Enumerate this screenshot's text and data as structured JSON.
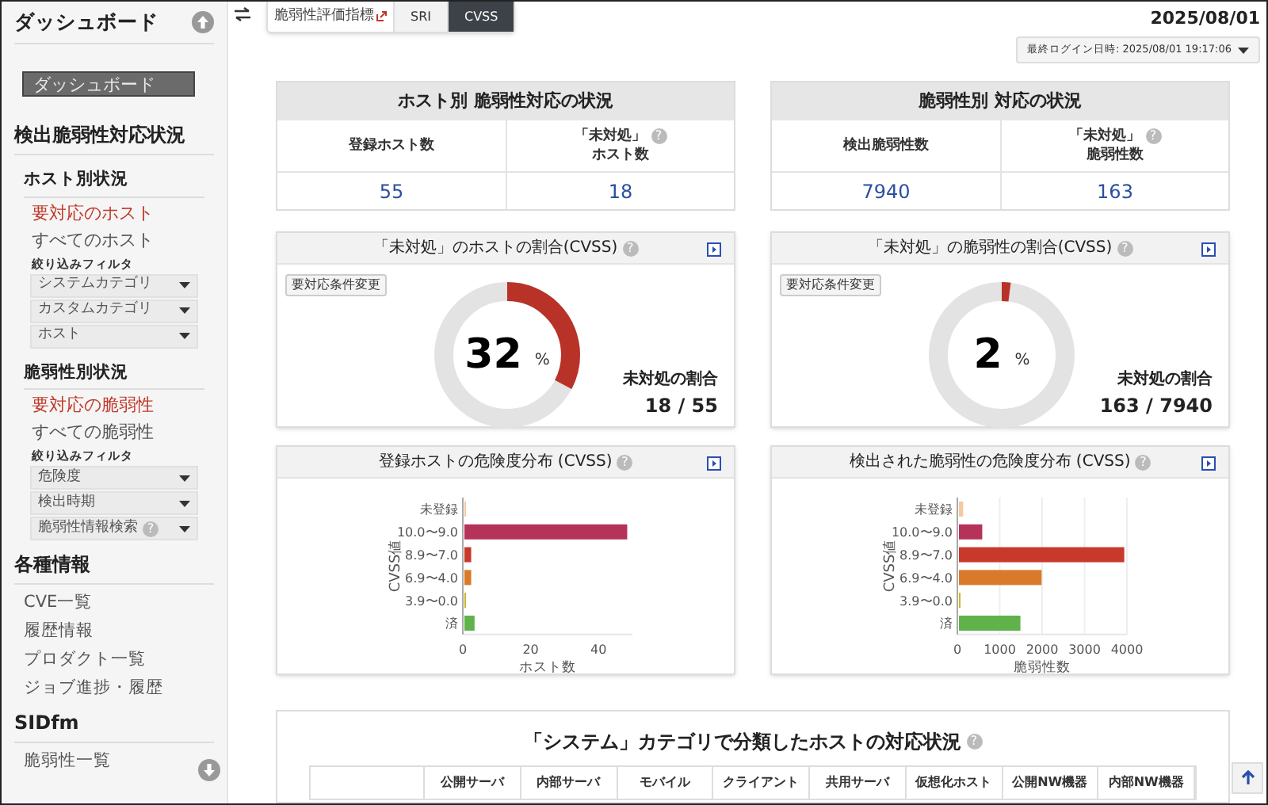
{
  "sidebar": {
    "title": "ダッシュボード",
    "items": [
      {
        "kind": "button",
        "label": "ダッシュボード"
      },
      {
        "kind": "heading",
        "label": "検出脆弱性対応状況"
      },
      {
        "kind": "subheading",
        "label": "ホスト別状況"
      },
      {
        "kind": "link",
        "label": "要対応のホスト",
        "selected": true
      },
      {
        "kind": "link",
        "label": "すべてのホスト",
        "selected": false
      },
      {
        "kind": "filter_label",
        "label": "絞り込みフィルタ"
      },
      {
        "kind": "dropdown",
        "label": "システムカテゴリ"
      },
      {
        "kind": "dropdown",
        "label": "カスタムカテゴリ"
      },
      {
        "kind": "dropdown",
        "label": "ホスト"
      },
      {
        "kind": "subheading",
        "label": "脆弱性別状況"
      },
      {
        "kind": "link",
        "label": "要対応の脆弱性",
        "selected": true
      },
      {
        "kind": "link",
        "label": "すべての脆弱性",
        "selected": false
      },
      {
        "kind": "filter_label",
        "label": "絞り込みフィルタ"
      },
      {
        "kind": "dropdown",
        "label": "危険度"
      },
      {
        "kind": "dropdown",
        "label": "検出時期"
      },
      {
        "kind": "dropdown",
        "label": "脆弱性情報検索",
        "help": "?"
      },
      {
        "kind": "heading",
        "label": "各種情報"
      },
      {
        "kind": "nav",
        "label": "CVE一覧"
      },
      {
        "kind": "nav",
        "label": "履歴情報"
      },
      {
        "kind": "nav",
        "label": "プロダクト一覧"
      },
      {
        "kind": "nav",
        "label": "ジョブ進捗・履歴"
      },
      {
        "kind": "heading",
        "label": "SIDfm"
      },
      {
        "kind": "nav",
        "label": "脆弱性一覧"
      }
    ]
  },
  "metric_selector": {
    "label": "脆弱性評価指標",
    "options": [
      {
        "label": "SRI",
        "selected": false
      },
      {
        "label": "CVSS",
        "selected": true
      }
    ]
  },
  "date": "2025/08/01",
  "last_login": "最終ログイン日時: 2025/08/01 19:17:06",
  "summary_cards": [
    {
      "title": "ホスト別 脆弱性対応の状況",
      "cells": [
        {
          "label_lines": [
            "登録ホスト数"
          ],
          "value": "55"
        },
        {
          "label_lines": [
            "「未対処」",
            "ホスト数"
          ],
          "help": "?",
          "value": "18"
        }
      ]
    },
    {
      "title": "脆弱性別 対応の状況",
      "cells": [
        {
          "label_lines": [
            "検出脆弱性数"
          ],
          "value": "7940"
        },
        {
          "label_lines": [
            "「未対処」",
            "脆弱性数"
          ],
          "help": "?",
          "value": "163"
        }
      ]
    }
  ],
  "donut_cards": [
    {
      "title": "「未対処」のホストの割合(CVSS)",
      "help": "?",
      "button": "要対応条件変更",
      "value": "32",
      "unit": "%",
      "level": 0.327,
      "caption": "未対処の割合",
      "ratio": "18 / 55"
    },
    {
      "title": "「未対処」の脆弱性の割合(CVSS)",
      "help": "?",
      "button": "要対応条件変更",
      "value": "2",
      "unit": "%",
      "level": 0.02,
      "caption": "未対処の割合",
      "ratio": "163 / 7940"
    }
  ],
  "chart_cards": [
    {
      "title": "登録ホストの危険度分布 (CVSS)",
      "help": "?",
      "chart_data": {
        "type": "bar",
        "orientation": "horizontal",
        "xlabel": "ホスト数",
        "ylabel": "CVSS値",
        "categories": [
          "未登録",
          "10.0〜9.0",
          "8.9〜7.0",
          "6.9〜4.0",
          "3.9〜0.0",
          "済"
        ],
        "series": [
          {
            "values": [
              0,
              48,
              2,
              2,
              0,
              3
            ],
            "colors": [
              "#f5c9a0",
              "#b5335a",
              "#c9392b",
              "#d97a2b",
              "#c9b52b",
              "#5fb34a"
            ]
          }
        ],
        "xlim": [
          0,
          50
        ],
        "xticks": [
          0,
          20,
          40
        ],
        "grid": false
      }
    },
    {
      "title": "検出された脆弱性の危険度分布 (CVSS)",
      "help": "?",
      "chart_data": {
        "type": "bar",
        "orientation": "horizontal",
        "xlabel": "脆弱性数",
        "ylabel": "CVSS値",
        "categories": [
          "未登録",
          "10.0〜9.0",
          "8.9〜7.0",
          "6.9〜4.0",
          "3.9〜0.0",
          "済"
        ],
        "series": [
          {
            "values": [
              100,
              550,
              3900,
              1950,
              30,
              1450
            ],
            "colors": [
              "#f5c9a0",
              "#b5335a",
              "#c9392b",
              "#d97a2b",
              "#c9b52b",
              "#5fb34a"
            ]
          }
        ],
        "xlim": [
          0,
          4000
        ],
        "xticks": [
          0,
          1000,
          2000,
          3000,
          4000
        ],
        "grid": true
      }
    }
  ],
  "category_table": {
    "title": "「システム」カテゴリで分類したホストの対応状況",
    "help": "?",
    "columns": [
      "公開サーバ",
      "内部サーバ",
      "モバイル",
      "クライアント",
      "共用サーバ",
      "仮想化ホスト",
      "公開NW機器",
      "内部NW機器"
    ]
  }
}
